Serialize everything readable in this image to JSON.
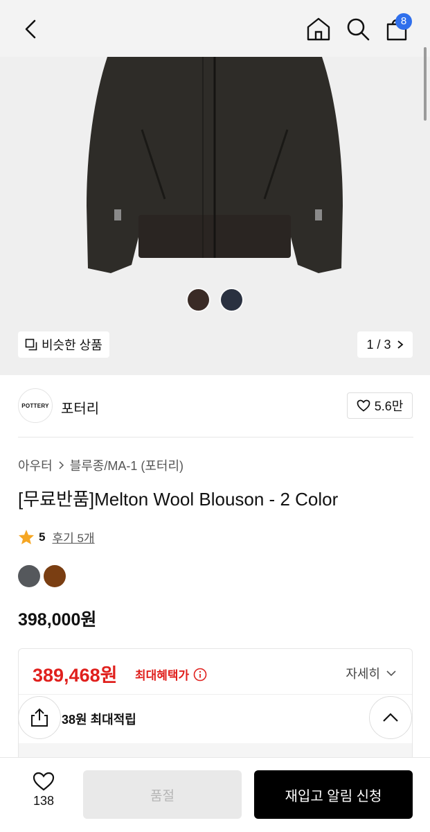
{
  "header": {
    "cart_count": "8"
  },
  "gallery": {
    "similar_label": "비슷한 상품",
    "page_indicator": "1 / 3",
    "dot_colors": [
      "#3a2b26",
      "#2a3140"
    ]
  },
  "brand": {
    "logo_text": "POTTERY",
    "name": "포터리",
    "likes": "5.6만"
  },
  "breadcrumb": [
    "아우터",
    "블루종/MA-1 (포터리)"
  ],
  "product": {
    "title": "[무료반품]Melton Wool Blouson - 2 Color",
    "rating": "5",
    "reviews_label": "후기 5개",
    "colors": [
      "#55585c",
      "#7a3e12"
    ],
    "price": "398,000원"
  },
  "benefit": {
    "sale_price": "389,468원",
    "sale_label": "최대혜택가",
    "detail_label": "자세히",
    "points_label": "38원 최대적립"
  },
  "bottom_bar": {
    "wish_count": "138",
    "soldout_label": "품절",
    "restock_label": "재입고 알림 신청"
  },
  "colors": {
    "accent_red": "#e0201d",
    "badge_blue": "#2f6fec"
  }
}
